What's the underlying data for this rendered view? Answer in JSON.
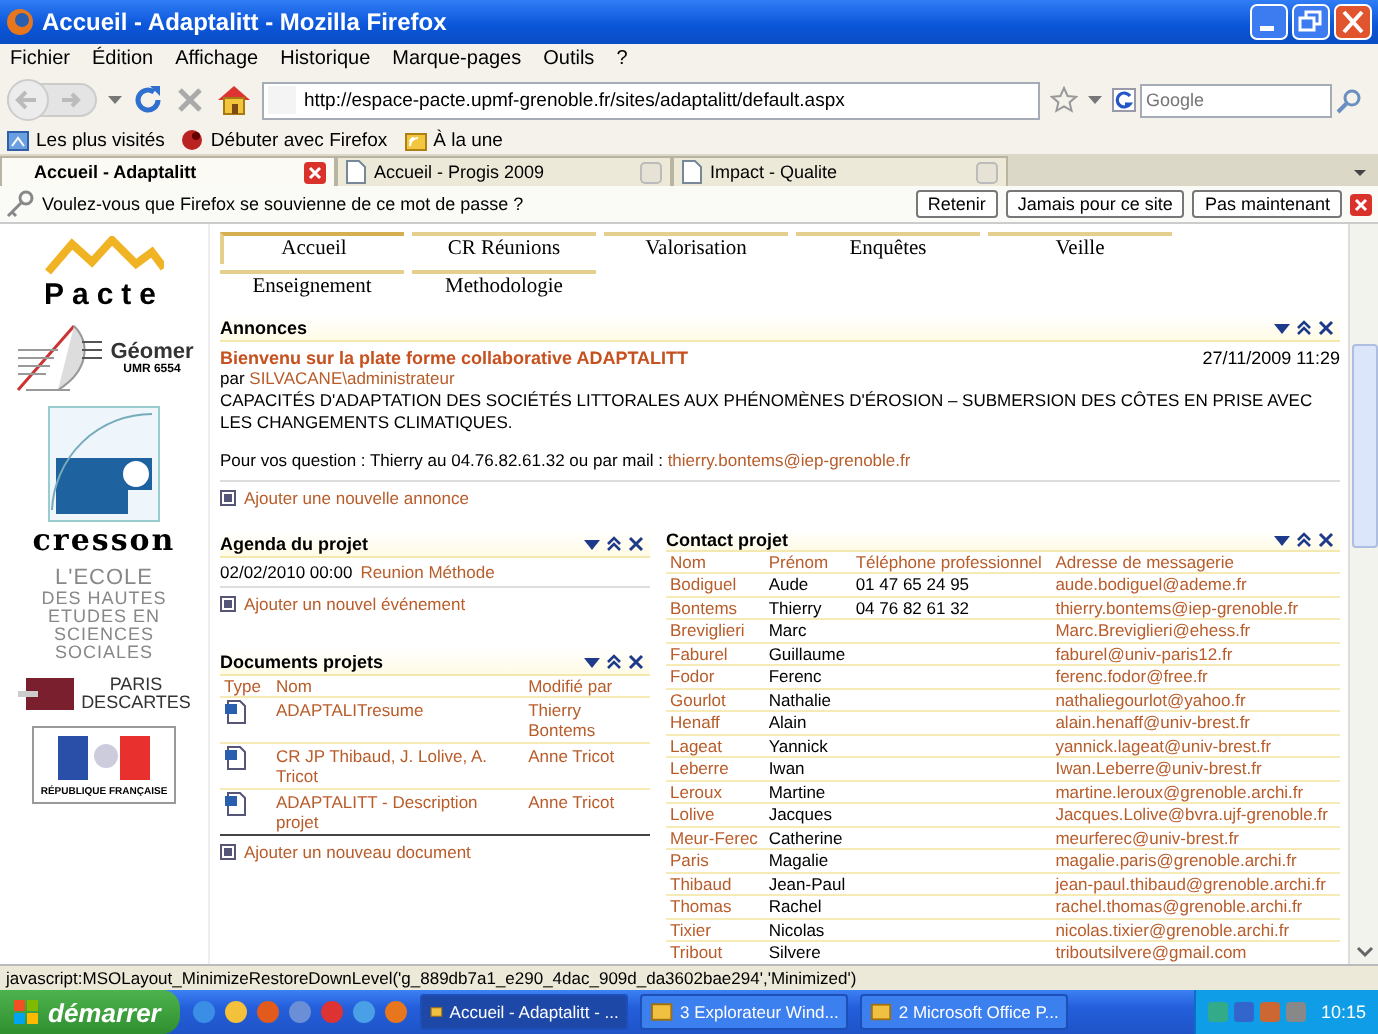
{
  "window": {
    "title": "Accueil - Adaptalitt - Mozilla Firefox"
  },
  "menu": [
    "Fichier",
    "Édition",
    "Affichage",
    "Historique",
    "Marque-pages",
    "Outils",
    "?"
  ],
  "toolbar": {
    "url": "http://espace-pacte.upmf-grenoble.fr/sites/adaptalitt/default.aspx",
    "search_placeholder": "Google"
  },
  "bookmarks": [
    "Les plus visités",
    "Débuter avec Firefox",
    "À la une"
  ],
  "browser_tabs": [
    {
      "label": "Accueil - Adaptalitt",
      "selected": true
    },
    {
      "label": "Accueil - Progis 2009",
      "selected": false
    },
    {
      "label": "Impact - Qualite",
      "selected": false
    }
  ],
  "password_bar": {
    "message": "Voulez-vous que Firefox se souvienne de ce mot de passe ?",
    "buttons": [
      "Retenir",
      "Jamais pour ce site",
      "Pas maintenant"
    ]
  },
  "logos": [
    {
      "kind": "pacte",
      "lines": [
        "Pacte"
      ]
    },
    {
      "kind": "geomer",
      "lines": [
        "Géomer",
        "UMR 6554"
      ]
    },
    {
      "kind": "cresson",
      "lines": [
        "cresson"
      ]
    },
    {
      "kind": "ehess",
      "lines": [
        "L'ECOLE",
        "DES HAUTES",
        "ETUDES EN",
        "SCIENCES",
        "SOCIALES"
      ]
    },
    {
      "kind": "descartes",
      "lines": [
        "PARIS",
        "DESCARTES"
      ]
    },
    {
      "kind": "republique",
      "lines": [
        "RÉPUBLIQUE FRANÇAISE"
      ]
    }
  ],
  "site_tabs": [
    {
      "label": "Accueil",
      "selected": true
    },
    {
      "label": "CR Réunions",
      "selected": false
    },
    {
      "label": "Valorisation",
      "selected": false
    },
    {
      "label": "Enquêtes",
      "selected": false
    },
    {
      "label": "Veille",
      "selected": false
    },
    {
      "label": "Enseignement",
      "selected": false
    },
    {
      "label": "Methodologie",
      "selected": false
    }
  ],
  "announcements": {
    "title": "Annonces",
    "items": [
      {
        "title": "Bienvenu sur la plate forme collaborative ADAPTALITT",
        "date": "27/11/2009 11:29",
        "author_prefix": "par",
        "author": "SILVACANE\\administrateur",
        "body": "CAPACITÉS D'ADAPTATION DES SOCIÉTÉS LITTORALES AUX PHÉNOMÈNES D'ÉROSION – SUBMERSION DES CÔTES EN PRISE AVEC LES CHANGEMENTS CLIMATIQUES.",
        "contact_text": "Pour vos question : Thierry au 04.76.82.61.32 ou par mail :",
        "contact_email": "thierry.bontems@iep-grenoble.fr"
      }
    ],
    "add_link": "Ajouter une nouvelle annonce"
  },
  "agenda": {
    "title": "Agenda du projet",
    "events": [
      {
        "date": "02/02/2010 00:00",
        "title": "Reunion Méthode"
      }
    ],
    "add_link": "Ajouter un nouvel événement"
  },
  "documents": {
    "title": "Documents projets",
    "columns": [
      "Type",
      "Nom",
      "Modifié par"
    ],
    "rows": [
      {
        "name": "ADAPTALITresume",
        "modified_by": "Thierry Bontems"
      },
      {
        "name": "CR JP Thibaud, J. Lolive, A. Tricot",
        "modified_by": "Anne Tricot"
      },
      {
        "name": "ADAPTALITT - Description projet",
        "modified_by": "Anne Tricot"
      }
    ],
    "add_link": "Ajouter un nouveau document"
  },
  "contacts": {
    "title": "Contact projet",
    "columns": [
      "Nom",
      "Prénom",
      "Téléphone professionnel",
      "Adresse de messagerie"
    ],
    "rows": [
      {
        "nom": "Bodiguel",
        "prenom": "Aude",
        "telephone": "01 47 65 24 95",
        "email": "aude.bodiguel@ademe.fr"
      },
      {
        "nom": "Bontems",
        "prenom": "Thierry",
        "telephone": "04 76 82 61 32",
        "email": "thierry.bontems@iep-grenoble.fr"
      },
      {
        "nom": "Breviglieri",
        "prenom": "Marc",
        "email": "Marc.Breviglieri@ehess.fr"
      },
      {
        "nom": "Faburel",
        "prenom": "Guillaume",
        "email": "faburel@univ-paris12.fr"
      },
      {
        "nom": "Fodor",
        "prenom": "Ferenc",
        "email": "ferenc.fodor@free.fr"
      },
      {
        "nom": "Gourlot",
        "prenom": "Nathalie",
        "email": "nathaliegourlot@yahoo.fr"
      },
      {
        "nom": "Henaff",
        "prenom": "Alain",
        "email": "alain.henaff@univ-brest.fr"
      },
      {
        "nom": "Lageat",
        "prenom": "Yannick",
        "email": "yannick.lageat@univ-brest.fr"
      },
      {
        "nom": "Leberre",
        "prenom": "Iwan",
        "email": "Iwan.Leberre@univ-brest.fr"
      },
      {
        "nom": "Leroux",
        "prenom": "Martine",
        "email": "martine.leroux@grenoble.archi.fr"
      },
      {
        "nom": "Lolive",
        "prenom": "Jacques",
        "email": "Jacques.Lolive@bvra.ujf-grenoble.fr"
      },
      {
        "nom": "Meur-Ferec",
        "prenom": "Catherine",
        "email": "meurferec@univ-brest.fr"
      },
      {
        "nom": "Paris",
        "prenom": "Magalie",
        "email": "magalie.paris@grenoble.archi.fr"
      },
      {
        "nom": "Thibaud",
        "prenom": "Jean-Paul",
        "email": "jean-paul.thibaud@grenoble.archi.fr"
      },
      {
        "nom": "Thomas",
        "prenom": "Rachel",
        "email": "rachel.thomas@grenoble.archi.fr"
      },
      {
        "nom": "Tixier",
        "prenom": "Nicolas",
        "email": "nicolas.tixier@grenoble.archi.fr"
      },
      {
        "nom": "Tribout",
        "prenom": "Silvere",
        "email": "triboutsilvere@gmail.com"
      }
    ]
  },
  "status_bar": {
    "text": "javascript:MSOLayout_MinimizeRestoreDownLevel('g_889db7a1_e290_4dac_909d_da3602bae294','Minimized')"
  },
  "taskbar": {
    "start": "démarrer",
    "tasks": [
      {
        "label": "Accueil - Adaptalitt - ...",
        "selected": true
      },
      {
        "label": "3 Explorateur Wind...",
        "selected": false
      },
      {
        "label": "2 Microsoft Office P...",
        "selected": false
      }
    ],
    "clock": "10:15"
  }
}
